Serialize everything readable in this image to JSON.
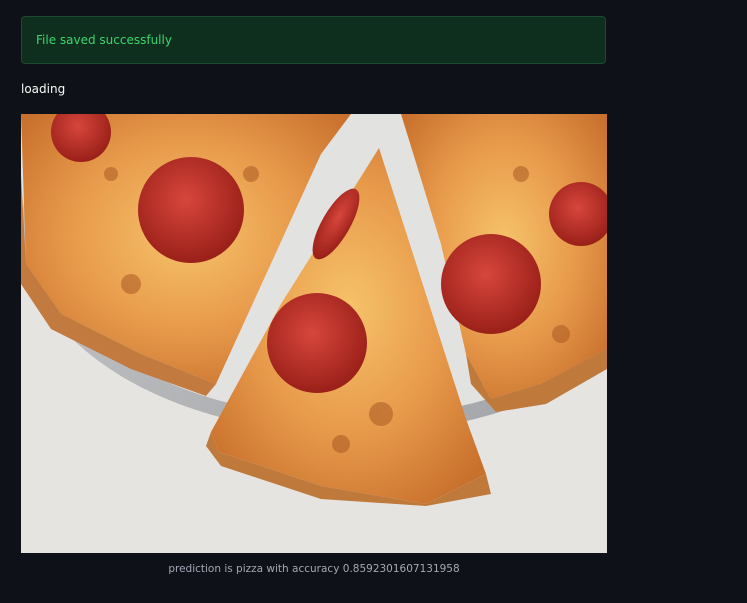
{
  "alert": {
    "message": "File saved successfully",
    "type": "success"
  },
  "status": {
    "text": "loading"
  },
  "image": {
    "subject": "pepperoni pizza slices"
  },
  "caption": {
    "text": "prediction is pizza with accuracy 0.8592301607131958"
  },
  "colors": {
    "background": "#0e1117",
    "success_bg": "#0f2f1e",
    "success_text": "#3dd56d",
    "caption_text": "#a3a8b4"
  }
}
